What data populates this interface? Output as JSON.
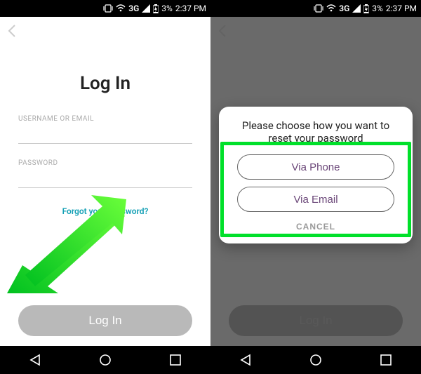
{
  "status": {
    "network": "3G",
    "battery": "3%",
    "time": "2:37 PM"
  },
  "left": {
    "title": "Log In",
    "usernameLabel": "USERNAME OR EMAIL",
    "usernameValue": "",
    "passwordLabel": "PASSWORD",
    "passwordValue": "",
    "forgot": "Forgot your password?",
    "loginBtn": "Log In"
  },
  "right": {
    "modalTitle": "Please choose how you want to reset your password",
    "optionPhone": "Via Phone",
    "optionEmail": "Via Email",
    "cancel": "CANCEL",
    "loginBtn": "Log In"
  }
}
